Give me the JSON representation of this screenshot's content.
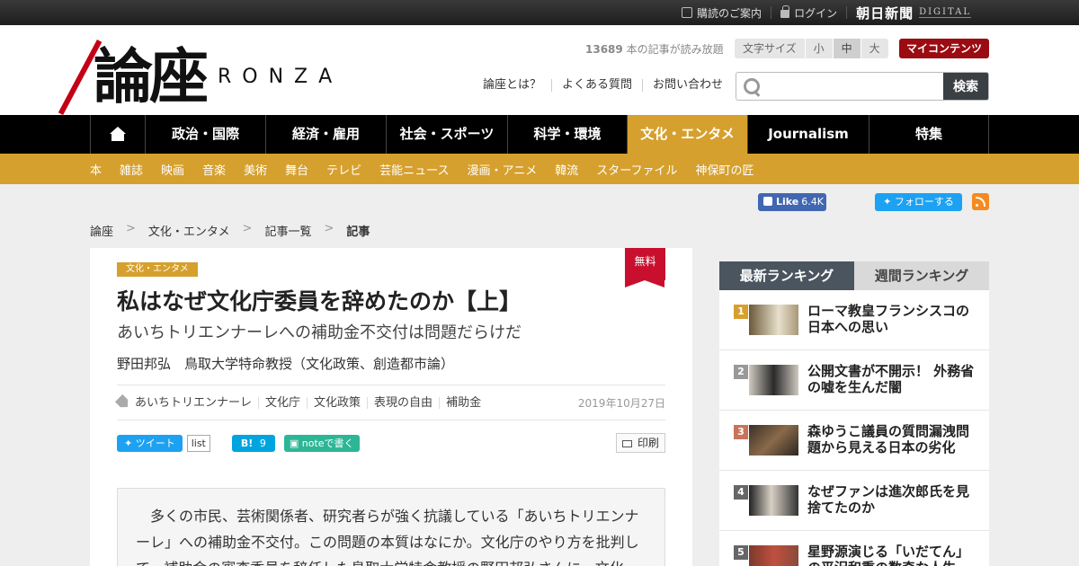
{
  "topbar": {
    "subscribe": "購読のご案内",
    "login": "ログイン",
    "asahi": "朝日新聞",
    "digital": "DIGITAL"
  },
  "header": {
    "logo_kanji": "論座",
    "logo_latin": "RONZA",
    "free_count": "13689",
    "free_text": " 本の記事が読み放題",
    "font_size_label": "文字サイズ",
    "font_sizes": [
      "小",
      "中",
      "大"
    ],
    "font_size_selected": "中",
    "my_contents": "マイコンテンツ",
    "links": [
      "論座とは？",
      "よくある質問",
      "お問い合わせ"
    ],
    "search_placeholder": "",
    "search_button": "検索"
  },
  "nav": {
    "items": [
      "政治・国際",
      "経済・雇用",
      "社会・スポーツ",
      "科学・環境",
      "文化・エンタメ",
      "Journalism",
      "特集"
    ],
    "active": "文化・エンタメ",
    "active_color": "#d6a02e"
  },
  "subnav": {
    "items": [
      "本",
      "雑誌",
      "映画",
      "音楽",
      "美術",
      "舞台",
      "テレビ",
      "芸能ニュース",
      "漫画・アニメ",
      "韓流",
      "スターファイル",
      "神保町の匠"
    ]
  },
  "social": {
    "fb_like": "Like",
    "fb_count": "6.4K",
    "twitter_follow": "フォローする"
  },
  "breadcrumb": [
    "論座",
    "文化・エンタメ",
    "記事一覧",
    "記事"
  ],
  "article": {
    "badge_free": "無料",
    "category": "文化・エンタメ",
    "title": "私はなぜ文化庁委員を辞めたのか【上】",
    "subtitle": "あいちトリエンナーレへの補助金不交付は問題だらけだ",
    "author": "野田邦弘　鳥取大学特命教授（文化政策、創造都市論）",
    "tags": [
      "あいちトリエンナーレ",
      "文化庁",
      "文化政策",
      "表現の自由",
      "補助金"
    ],
    "date": "2019年10月27日",
    "share": {
      "tweet": "ツイート",
      "tweet_count": "list",
      "hatena": "B!",
      "hatena_count": "9",
      "note": "noteで書く",
      "print": "印刷"
    },
    "lead": "　多くの市民、芸術関係者、研究者らが強く抗議している「あいちトリエンナーレ」への補助金不交付。この問題の本質はなにか。文化庁のやり方を批判して、補助金の審査委員を辞任した鳥取大学特命教授の野田邦弘さんに、文化"
  },
  "ranking": {
    "tabs": [
      "最新ランキング",
      "週間ランキング"
    ],
    "active_tab": "最新ランキング",
    "items": [
      {
        "rank": "1",
        "title": "ローマ教皇フランシスコの日本への思い",
        "rank_color": "#d6a02e"
      },
      {
        "rank": "2",
        "title": "公開文書が不開示！ 外務省の嘘を生んだ闇",
        "rank_color": "#999999"
      },
      {
        "rank": "3",
        "title": "森ゆうこ議員の質問漏洩問題から見える日本の劣化",
        "rank_color": "#c8735a"
      },
      {
        "rank": "4",
        "title": "なぜファンは進次郎氏を見捨てたのか",
        "rank_color": "#666666"
      },
      {
        "rank": "5",
        "title": "星野源演じる「いだてん」の平沢和重の数奇な人生",
        "rank_color": "#666666"
      }
    ]
  }
}
